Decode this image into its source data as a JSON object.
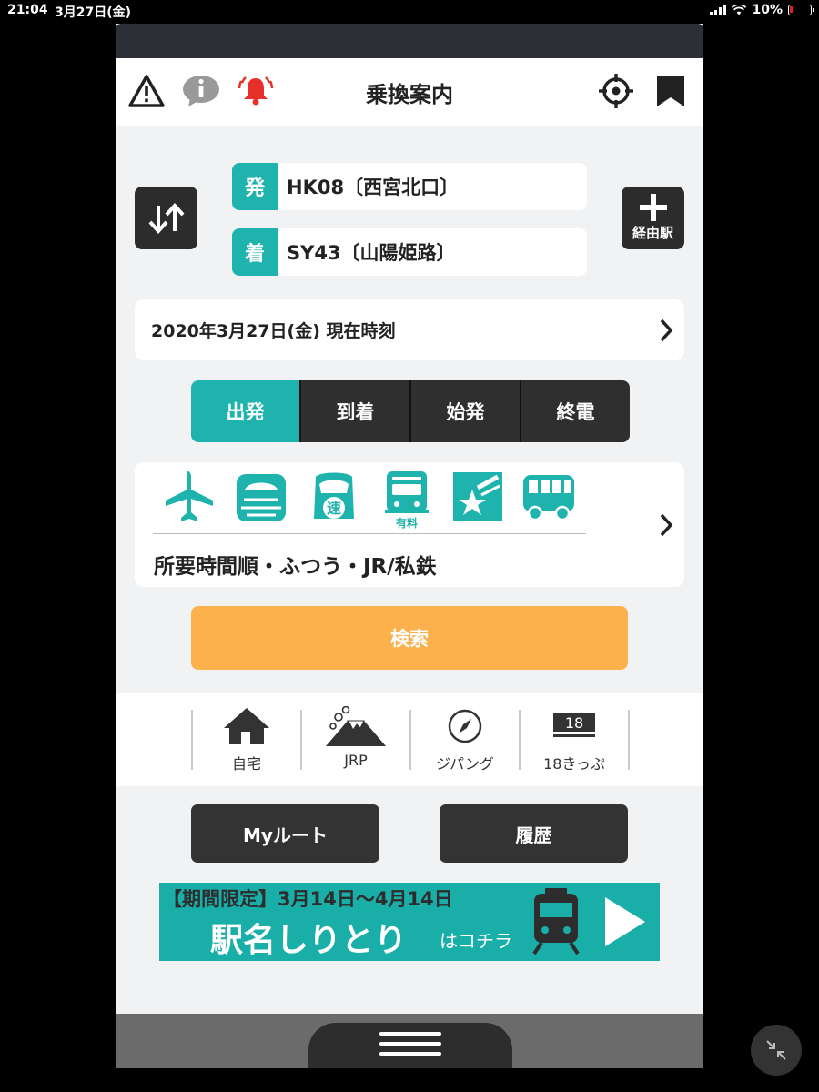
{
  "status_bar": {
    "time": "21:04",
    "date": "3月27日(金)",
    "battery": "10%"
  },
  "header": {
    "title": "乗換案内"
  },
  "route": {
    "from_badge": "発",
    "from_station": "HK08〔西宮北口〕",
    "to_badge": "着",
    "to_station": "SY43〔山陽姫路〕",
    "via_label": "経由駅"
  },
  "datetime": {
    "label": "2020年3月27日(金) 現在時刻"
  },
  "time_modes": [
    {
      "label": "出発",
      "active": true
    },
    {
      "label": "到着",
      "active": false
    },
    {
      "label": "始発",
      "active": false
    },
    {
      "label": "終電",
      "active": false
    }
  ],
  "transport": {
    "icons": [
      "airplane-icon",
      "shinkansen-icon",
      "express-bus-icon",
      "paid-express-icon",
      "star-icon",
      "bus-icon"
    ],
    "express_badge": "速",
    "paid_badge": "有料",
    "summary": "所要時間順・ふつう・JR/私鉄"
  },
  "search": {
    "label": "検索"
  },
  "quick_links": [
    {
      "label": "自宅",
      "icon": "home-icon"
    },
    {
      "label": "JRP",
      "icon": "mount-fuji-icon"
    },
    {
      "label": "ジパング",
      "icon": "compass-icon"
    },
    {
      "label": "18きっぷ",
      "icon": "ticket-18-icon",
      "badge": "18"
    }
  ],
  "buttons": {
    "my_route": "Myルート",
    "history": "履歴"
  },
  "banner": {
    "line1": "【期間限定】3月14日〜4月14日",
    "line2": "駅名しりとり",
    "line3": "はコチラ"
  },
  "colors": {
    "accent": "#1fb3ad",
    "search": "#fcb14d",
    "dark": "#2c2c2c",
    "alert": "#e8302a"
  }
}
